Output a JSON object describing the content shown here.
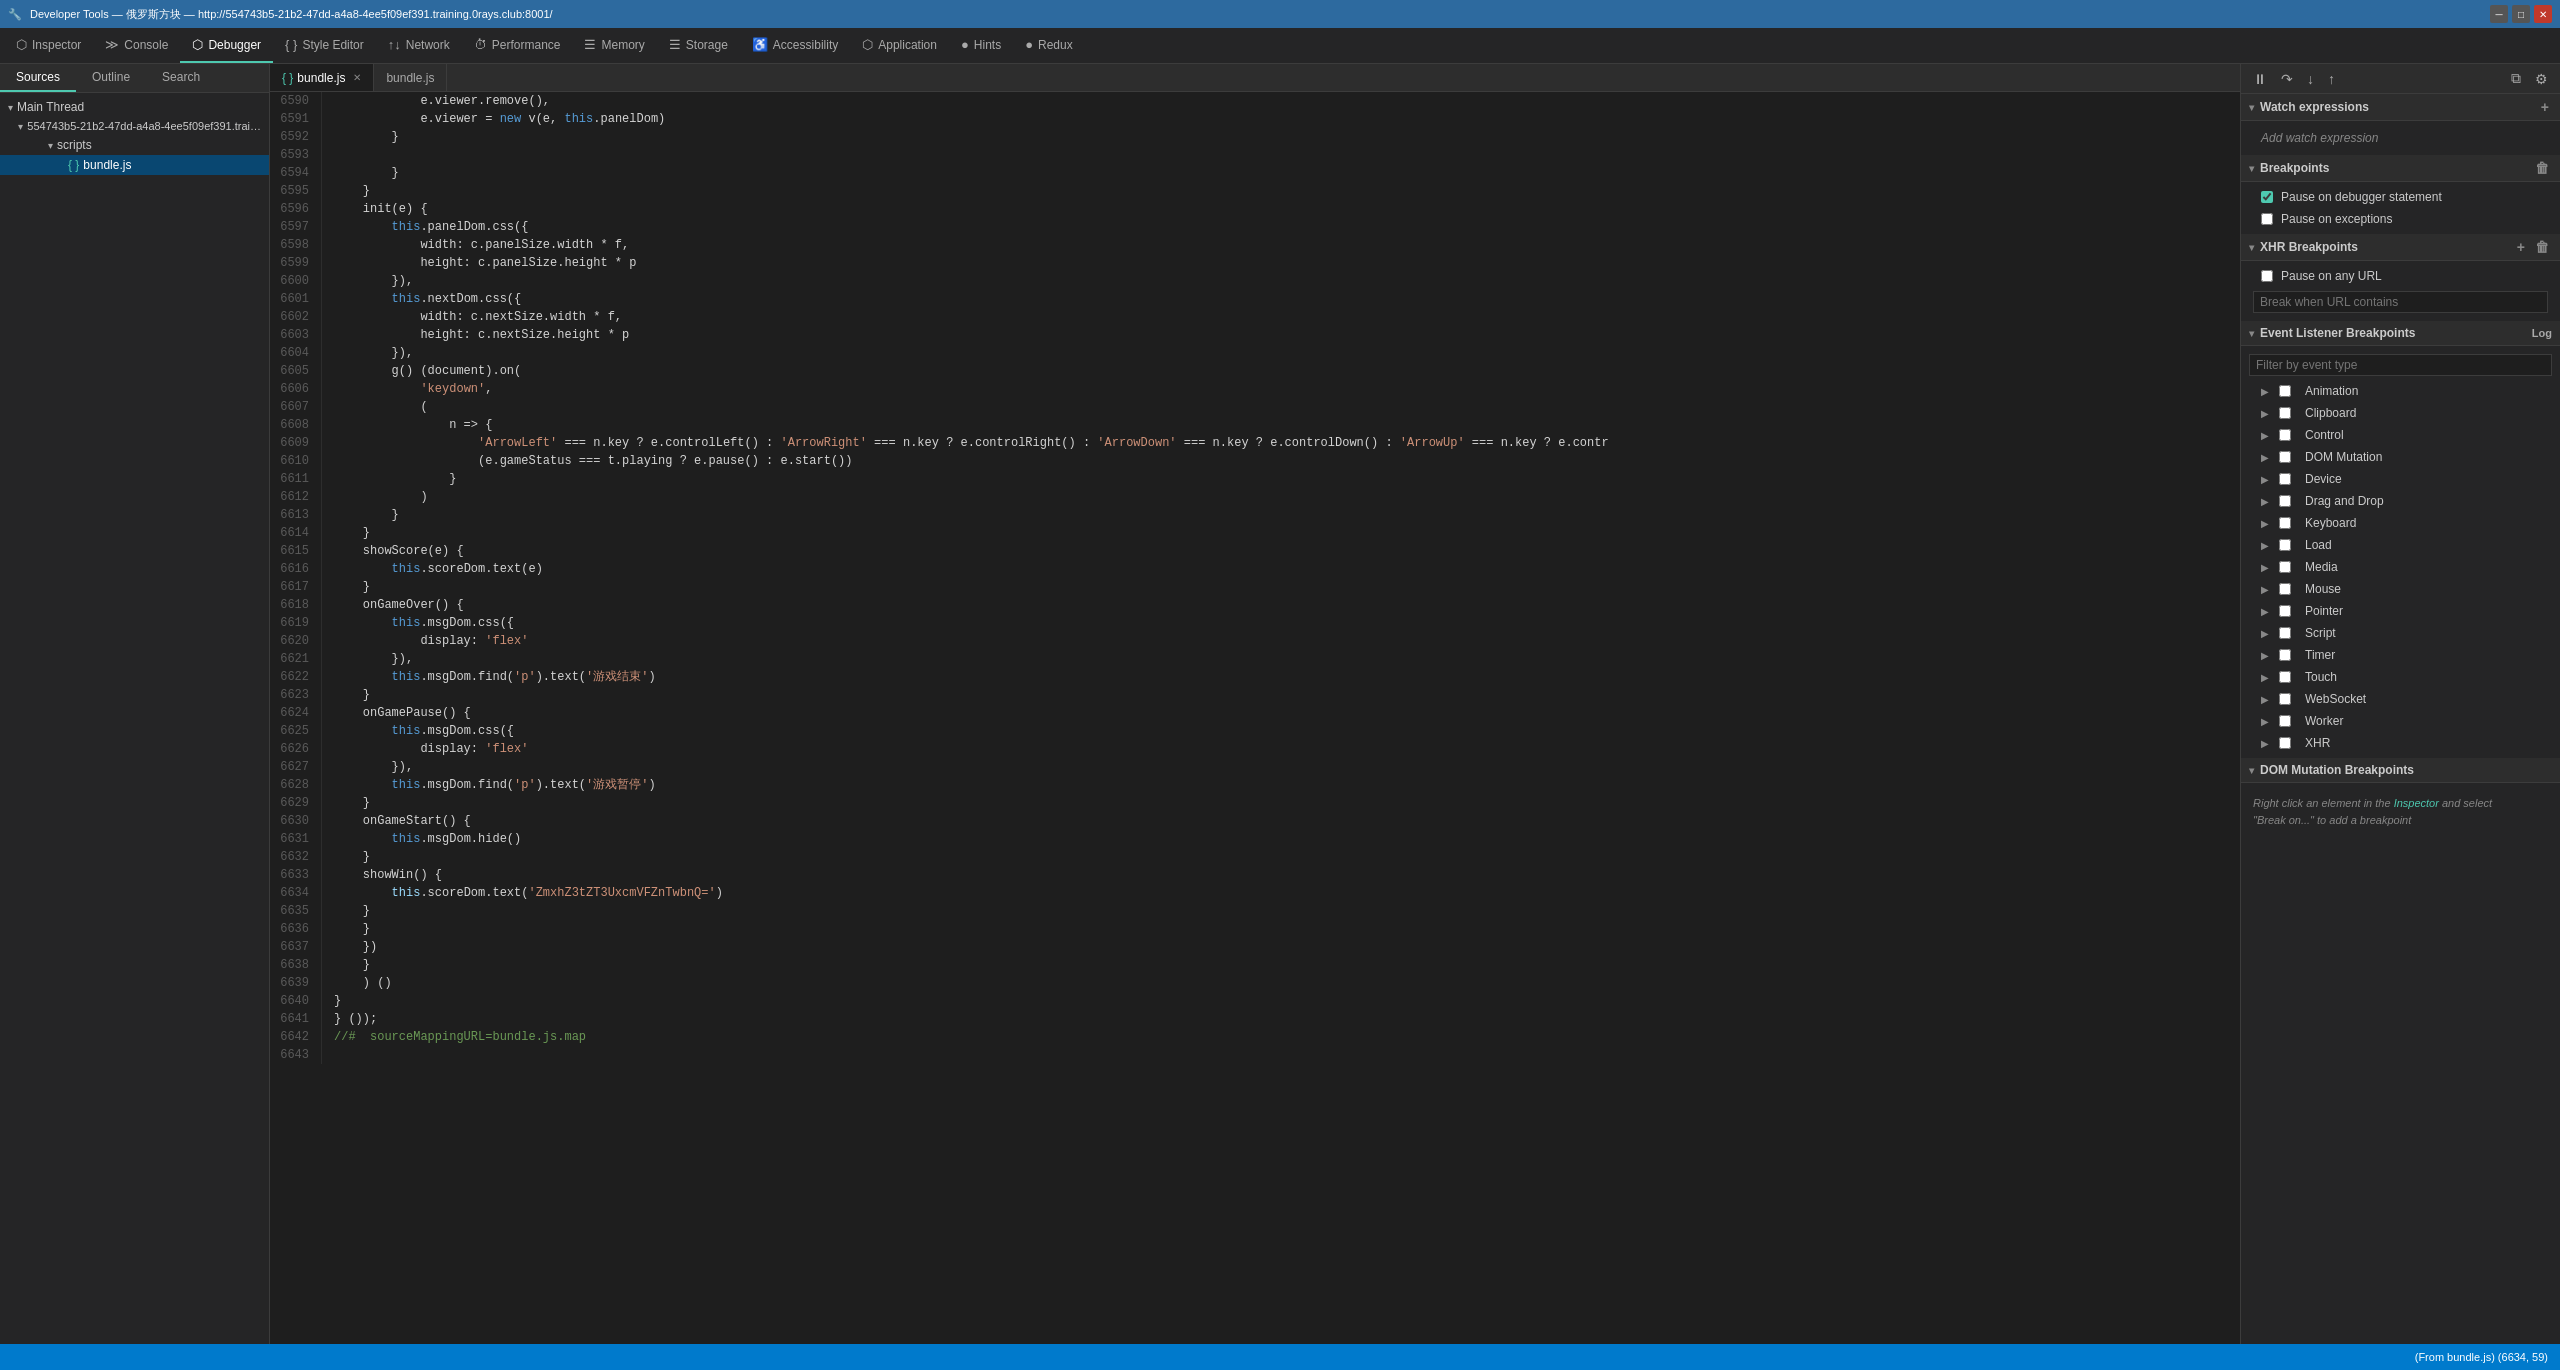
{
  "titlebar": {
    "title": "Developer Tools — 俄罗斯方块 — http://554743b5-21b2-47dd-a4a8-4ee5f09ef391.training.0rays.club:8001/",
    "win_min": "─",
    "win_max": "□",
    "win_close": "✕"
  },
  "tabs": [
    {
      "id": "inspector",
      "label": "Inspector",
      "icon": "⬡",
      "active": false
    },
    {
      "id": "console",
      "label": "Console",
      "icon": "≫",
      "active": false
    },
    {
      "id": "debugger",
      "label": "Debugger",
      "icon": "⬡",
      "active": true
    },
    {
      "id": "style-editor",
      "label": "Style Editor",
      "icon": "{ }",
      "active": false
    },
    {
      "id": "network",
      "label": "Network",
      "icon": "↑↓",
      "active": false
    },
    {
      "id": "performance",
      "label": "Performance",
      "icon": "⏱",
      "active": false
    },
    {
      "id": "memory",
      "label": "Memory",
      "icon": "☰",
      "active": false
    },
    {
      "id": "storage",
      "label": "Storage",
      "icon": "☰",
      "active": false
    },
    {
      "id": "accessibility",
      "label": "Accessibility",
      "icon": "♿",
      "active": false
    },
    {
      "id": "application",
      "label": "Application",
      "icon": "⬡",
      "active": false
    },
    {
      "id": "hints",
      "label": "Hints",
      "icon": "●",
      "active": false
    },
    {
      "id": "redux",
      "label": "Redux",
      "icon": "●",
      "active": false
    }
  ],
  "sources_tabs": [
    "Sources",
    "Outline",
    "Search"
  ],
  "file_tree": [
    {
      "label": "Main Thread",
      "indent": 0,
      "icon": "▾",
      "type": "group"
    },
    {
      "label": "554743b5-21b2-47dd-a4a8-4ee5f09ef391.trai…",
      "indent": 1,
      "icon": "▾",
      "type": "host"
    },
    {
      "label": "scripts",
      "indent": 2,
      "icon": "▾",
      "type": "folder"
    },
    {
      "label": "bundle.js",
      "indent": 3,
      "icon": "{ }",
      "type": "file",
      "selected": true
    }
  ],
  "editor_tabs": [
    {
      "label": "{ } bundle.js",
      "active": true,
      "closeable": true
    },
    {
      "label": "bundle.js",
      "active": false,
      "closeable": false
    }
  ],
  "code_lines": [
    {
      "num": 6590,
      "code": "            e.viewer.remove(),"
    },
    {
      "num": 6591,
      "code": "            e.viewer = new v(e, this.panelDom)"
    },
    {
      "num": 6592,
      "code": "        }"
    },
    {
      "num": 6593,
      "code": ""
    },
    {
      "num": 6594,
      "code": "        }"
    },
    {
      "num": 6595,
      "code": "    }"
    },
    {
      "num": 6596,
      "code": "    init(e) {"
    },
    {
      "num": 6597,
      "code": "        this.panelDom.css({"
    },
    {
      "num": 6598,
      "code": "            width: c.panelSize.width * f,"
    },
    {
      "num": 6599,
      "code": "            height: c.panelSize.height * p"
    },
    {
      "num": 6600,
      "code": "        }),"
    },
    {
      "num": 6601,
      "code": "        this.nextDom.css({"
    },
    {
      "num": 6602,
      "code": "            width: c.nextSize.width * f,"
    },
    {
      "num": 6603,
      "code": "            height: c.nextSize.height * p"
    },
    {
      "num": 6604,
      "code": "        }),"
    },
    {
      "num": 6605,
      "code": "        g() (document).on("
    },
    {
      "num": 6606,
      "code": "            'keydown',"
    },
    {
      "num": 6607,
      "code": "            ("
    },
    {
      "num": 6608,
      "code": "                n => {"
    },
    {
      "num": 6609,
      "code": "                    'ArrowLeft' === n.key ? e.controlLeft() : 'ArrowRight' === n.key ? e.controlRight() : 'ArrowDown' === n.key ? e.controlDown() : 'ArrowUp' === n.key ? e.contr"
    },
    {
      "num": 6610,
      "code": "                    (e.gameStatus === t.playing ? e.pause() : e.start())"
    },
    {
      "num": 6611,
      "code": "                }"
    },
    {
      "num": 6612,
      "code": "            )"
    },
    {
      "num": 6613,
      "code": "        }"
    },
    {
      "num": 6614,
      "code": "    }"
    },
    {
      "num": 6615,
      "code": "    showScore(e) {"
    },
    {
      "num": 6616,
      "code": "        this.scoreDom.text(e)"
    },
    {
      "num": 6617,
      "code": "    }"
    },
    {
      "num": 6618,
      "code": "    onGameOver() {"
    },
    {
      "num": 6619,
      "code": "        this.msgDom.css({"
    },
    {
      "num": 6620,
      "code": "            display: 'flex'"
    },
    {
      "num": 6621,
      "code": "        }),"
    },
    {
      "num": 6622,
      "code": "        this.msgDom.find('p').text('游戏结束')"
    },
    {
      "num": 6623,
      "code": "    }"
    },
    {
      "num": 6624,
      "code": "    onGamePause() {"
    },
    {
      "num": 6625,
      "code": "        this.msgDom.css({"
    },
    {
      "num": 6626,
      "code": "            display: 'flex'"
    },
    {
      "num": 6627,
      "code": "        }),"
    },
    {
      "num": 6628,
      "code": "        this.msgDom.find('p').text('游戏暂停')"
    },
    {
      "num": 6629,
      "code": "    }"
    },
    {
      "num": 6630,
      "code": "    onGameStart() {"
    },
    {
      "num": 6631,
      "code": "        this.msgDom.hide()"
    },
    {
      "num": 6632,
      "code": "    }"
    },
    {
      "num": 6633,
      "code": "    showWin() {"
    },
    {
      "num": 6634,
      "code": "        this.scoreDom.text('ZmxhZ3tZT3UxcmVFZnTwbnQ=')"
    },
    {
      "num": 6635,
      "code": "    }"
    },
    {
      "num": 6636,
      "code": "    }"
    },
    {
      "num": 6637,
      "code": "    })"
    },
    {
      "num": 6638,
      "code": "    }"
    },
    {
      "num": 6639,
      "code": "    ) ()"
    },
    {
      "num": 6640,
      "code": "}"
    },
    {
      "num": 6641,
      "code": "} ());"
    },
    {
      "num": 6642,
      "code": "//#  sourceMappingURL=bundle.js.map"
    },
    {
      "num": 6643,
      "code": ""
    }
  ],
  "right_panel": {
    "watch_expressions": {
      "title": "Watch expressions",
      "add_label": "+"
    },
    "breakpoints": {
      "title": "Breakpoints",
      "items": [
        {
          "label": "Pause on debugger statement",
          "checked": true
        },
        {
          "label": "Pause on exceptions",
          "checked": false
        }
      ]
    },
    "xhr_breakpoints": {
      "title": "XHR Breakpoints",
      "items": [
        {
          "label": "Pause on any URL",
          "checked": false
        }
      ],
      "input_placeholder": "Break when URL contains"
    },
    "event_listener_breakpoints": {
      "title": "Event Listener Breakpoints",
      "log_label": "Log",
      "filter_placeholder": "Filter by event type",
      "groups": [
        {
          "label": "Animation",
          "checked": false
        },
        {
          "label": "Clipboard",
          "checked": false
        },
        {
          "label": "Control",
          "checked": false
        },
        {
          "label": "DOM Mutation",
          "checked": false
        },
        {
          "label": "Device",
          "checked": false
        },
        {
          "label": "Drag and Drop",
          "checked": false
        },
        {
          "label": "Keyboard",
          "checked": false
        },
        {
          "label": "Load",
          "checked": false
        },
        {
          "label": "Media",
          "checked": false
        },
        {
          "label": "Mouse",
          "checked": false
        },
        {
          "label": "Pointer",
          "checked": false
        },
        {
          "label": "Script",
          "checked": false
        },
        {
          "label": "Timer",
          "checked": false
        },
        {
          "label": "Touch",
          "checked": false
        },
        {
          "label": "WebSocket",
          "checked": false
        },
        {
          "label": "Worker",
          "checked": false
        },
        {
          "label": "XHR",
          "checked": false
        }
      ]
    },
    "dom_mutation_breakpoints": {
      "title": "DOM Mutation Breakpoints",
      "info": "Right click an element in the Inspector and select \"Break on...\" to add a breakpoint"
    }
  },
  "statusbar": {
    "text": "(From bundle.js)  (6634, 59)"
  }
}
